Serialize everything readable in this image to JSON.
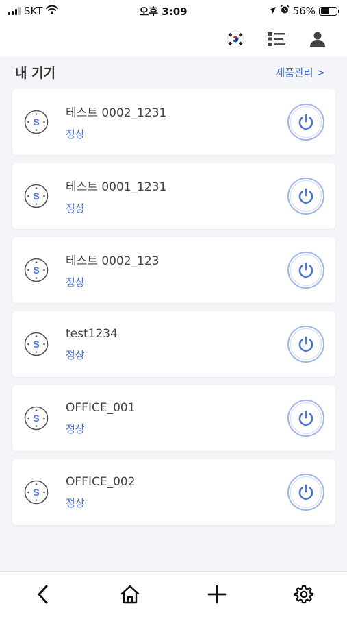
{
  "status_bar": {
    "carrier": "SKT",
    "time": "오후 3:09",
    "battery": "56%",
    "battery_level": 0.56,
    "icons": [
      "signal-icon",
      "wifi-icon",
      "location-arrow-icon",
      "alarm-icon",
      "battery-icon"
    ]
  },
  "header": {
    "icons": [
      "korean-flag-icon",
      "list-view-icon",
      "user-profile-icon"
    ]
  },
  "section": {
    "title": "내 기기",
    "manage_link": "제품관리 >"
  },
  "devices": [
    {
      "name": "테스트 0002_1231",
      "status": "정상"
    },
    {
      "name": "테스트 0001_1231",
      "status": "정상"
    },
    {
      "name": "테스트 0002_123",
      "status": "정상"
    },
    {
      "name": "test1234",
      "status": "정상"
    },
    {
      "name": "OFFICE_001",
      "status": "정상"
    },
    {
      "name": "OFFICE_002",
      "status": "정상"
    }
  ],
  "bottom_nav": {
    "icons": [
      "back-chevron-icon",
      "home-icon",
      "add-plus-icon",
      "settings-gear-icon"
    ]
  },
  "colors": {
    "accent": "#4a73d8",
    "power_ring": "#9fb6ee",
    "background": "#f4f5f8"
  }
}
